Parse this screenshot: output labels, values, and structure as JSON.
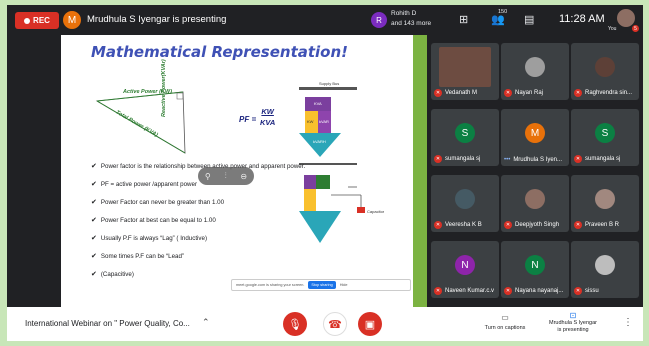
{
  "topbar": {
    "rec_label": "REC",
    "presenter_initial": "M",
    "presenting_text": "Mrudhula S Iyengar is presenting",
    "participants_initial": "R",
    "participants_line1": "Rohith D",
    "participants_line2": "and 143 more",
    "people_count": "150",
    "time": "11:28 AM",
    "you_label": "You",
    "notif_count": "5"
  },
  "slide": {
    "title": "Mathematical Representation!",
    "active_power_label": "Active Power (KW)",
    "total_power_label": "Total Power (KVA)",
    "reactive_power_label": "Reactive Power(KVAr)",
    "pf_prefix": "PF = ",
    "pf_num": "KW",
    "pf_den": "KVA",
    "supply_label": "Supply Bus",
    "kva_label": "KVA",
    "kw_label": "KW",
    "kvar_label": "kVAR",
    "kvarh_label": "kVARH",
    "capacitor_label": "Capacitor",
    "bullets": [
      "Power factor is the relationship between active power and apparent power.",
      "PF = active power /apparent power",
      "Power Factor can never be greater than 1.00",
      "Power Factor at best can be equal to 1.00",
      "Usually P.F is always “Lag” ( Inductive)",
      "Some times P.F can be “Lead”",
      "(Capacitive)"
    ],
    "share_text": "meet.google.com is sharing your screen.",
    "stop_sharing": "Stop sharing",
    "hide": "Hide"
  },
  "tiles": [
    {
      "name": "Vedanath M",
      "type": "photo",
      "color": "#6d4c41"
    },
    {
      "name": "Nayan Raj",
      "type": "photo",
      "color": "#9e9e9e"
    },
    {
      "name": "Raghvendra sin...",
      "type": "photo",
      "color": "#5d4037"
    },
    {
      "name": "sumangala sj",
      "type": "initial",
      "initial": "S",
      "color": "#0b8043"
    },
    {
      "name": "Mrudhula S Iyen...",
      "type": "initial",
      "initial": "M",
      "color": "#e8710a"
    },
    {
      "name": "sumangala sj",
      "type": "initial",
      "initial": "S",
      "color": "#0b8043"
    },
    {
      "name": "Veeresha K B",
      "type": "photo",
      "color": "#455a64"
    },
    {
      "name": "Deepjyoth Singh",
      "type": "photo",
      "color": "#8d6e63"
    },
    {
      "name": "Praveen B R",
      "type": "photo",
      "color": "#a1887f"
    },
    {
      "name": "Naveen Kumar.c.v",
      "type": "initial",
      "initial": "N",
      "color": "#8e24aa"
    },
    {
      "name": "Nayana nayanaj...",
      "type": "initial",
      "initial": "N",
      "color": "#0b8043"
    },
    {
      "name": "sissu",
      "type": "photo",
      "color": "#bdbdbd"
    }
  ],
  "bottombar": {
    "meeting_title": "International Webinar on \" Power Quality, Co...",
    "turn_on_captions": "Turn on captions",
    "presenting_label_line1": "Mrudhula S Iyengar",
    "presenting_label_line2": "is presenting"
  },
  "colors": {
    "accent": "#1a73e8",
    "danger": "#d93025",
    "meet_bg": "#202124"
  }
}
